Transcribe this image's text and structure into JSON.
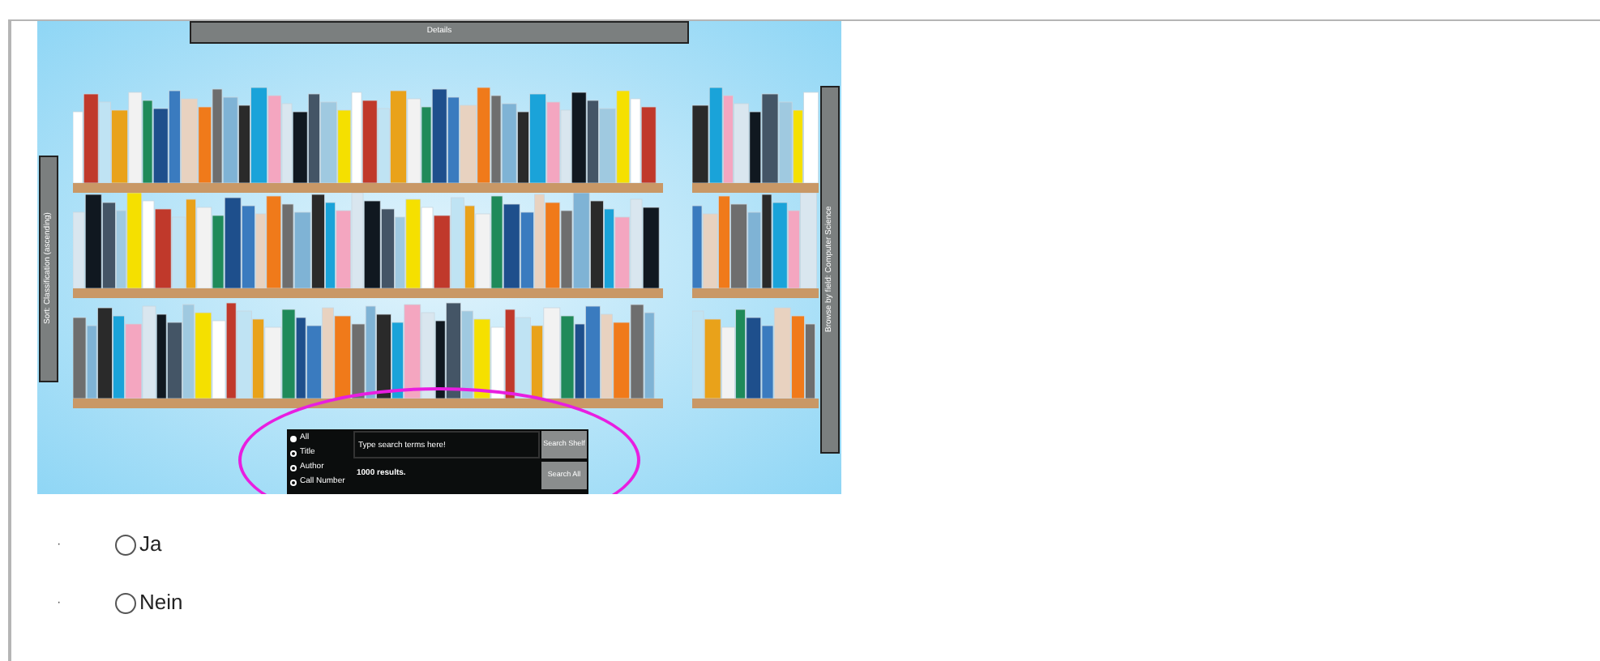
{
  "embedded_screenshot": {
    "top_tab": "Details",
    "left_tab": "Sort: Classification (ascending)",
    "right_tab": "Browse by field: Computer Science",
    "search": {
      "scopes": [
        {
          "label": "All",
          "selected": true
        },
        {
          "label": "Title",
          "selected": false
        },
        {
          "label": "Author",
          "selected": false
        },
        {
          "label": "Call Number",
          "selected": false
        }
      ],
      "placeholder": "Type search terms here!",
      "result_count": "1000 results.",
      "buttons": [
        "Search Shelf",
        "Search All"
      ]
    }
  },
  "question": {
    "options": [
      {
        "marker": "·",
        "label": "Ja",
        "selected": false
      },
      {
        "marker": "·",
        "label": "Nein",
        "selected": false
      }
    ]
  }
}
